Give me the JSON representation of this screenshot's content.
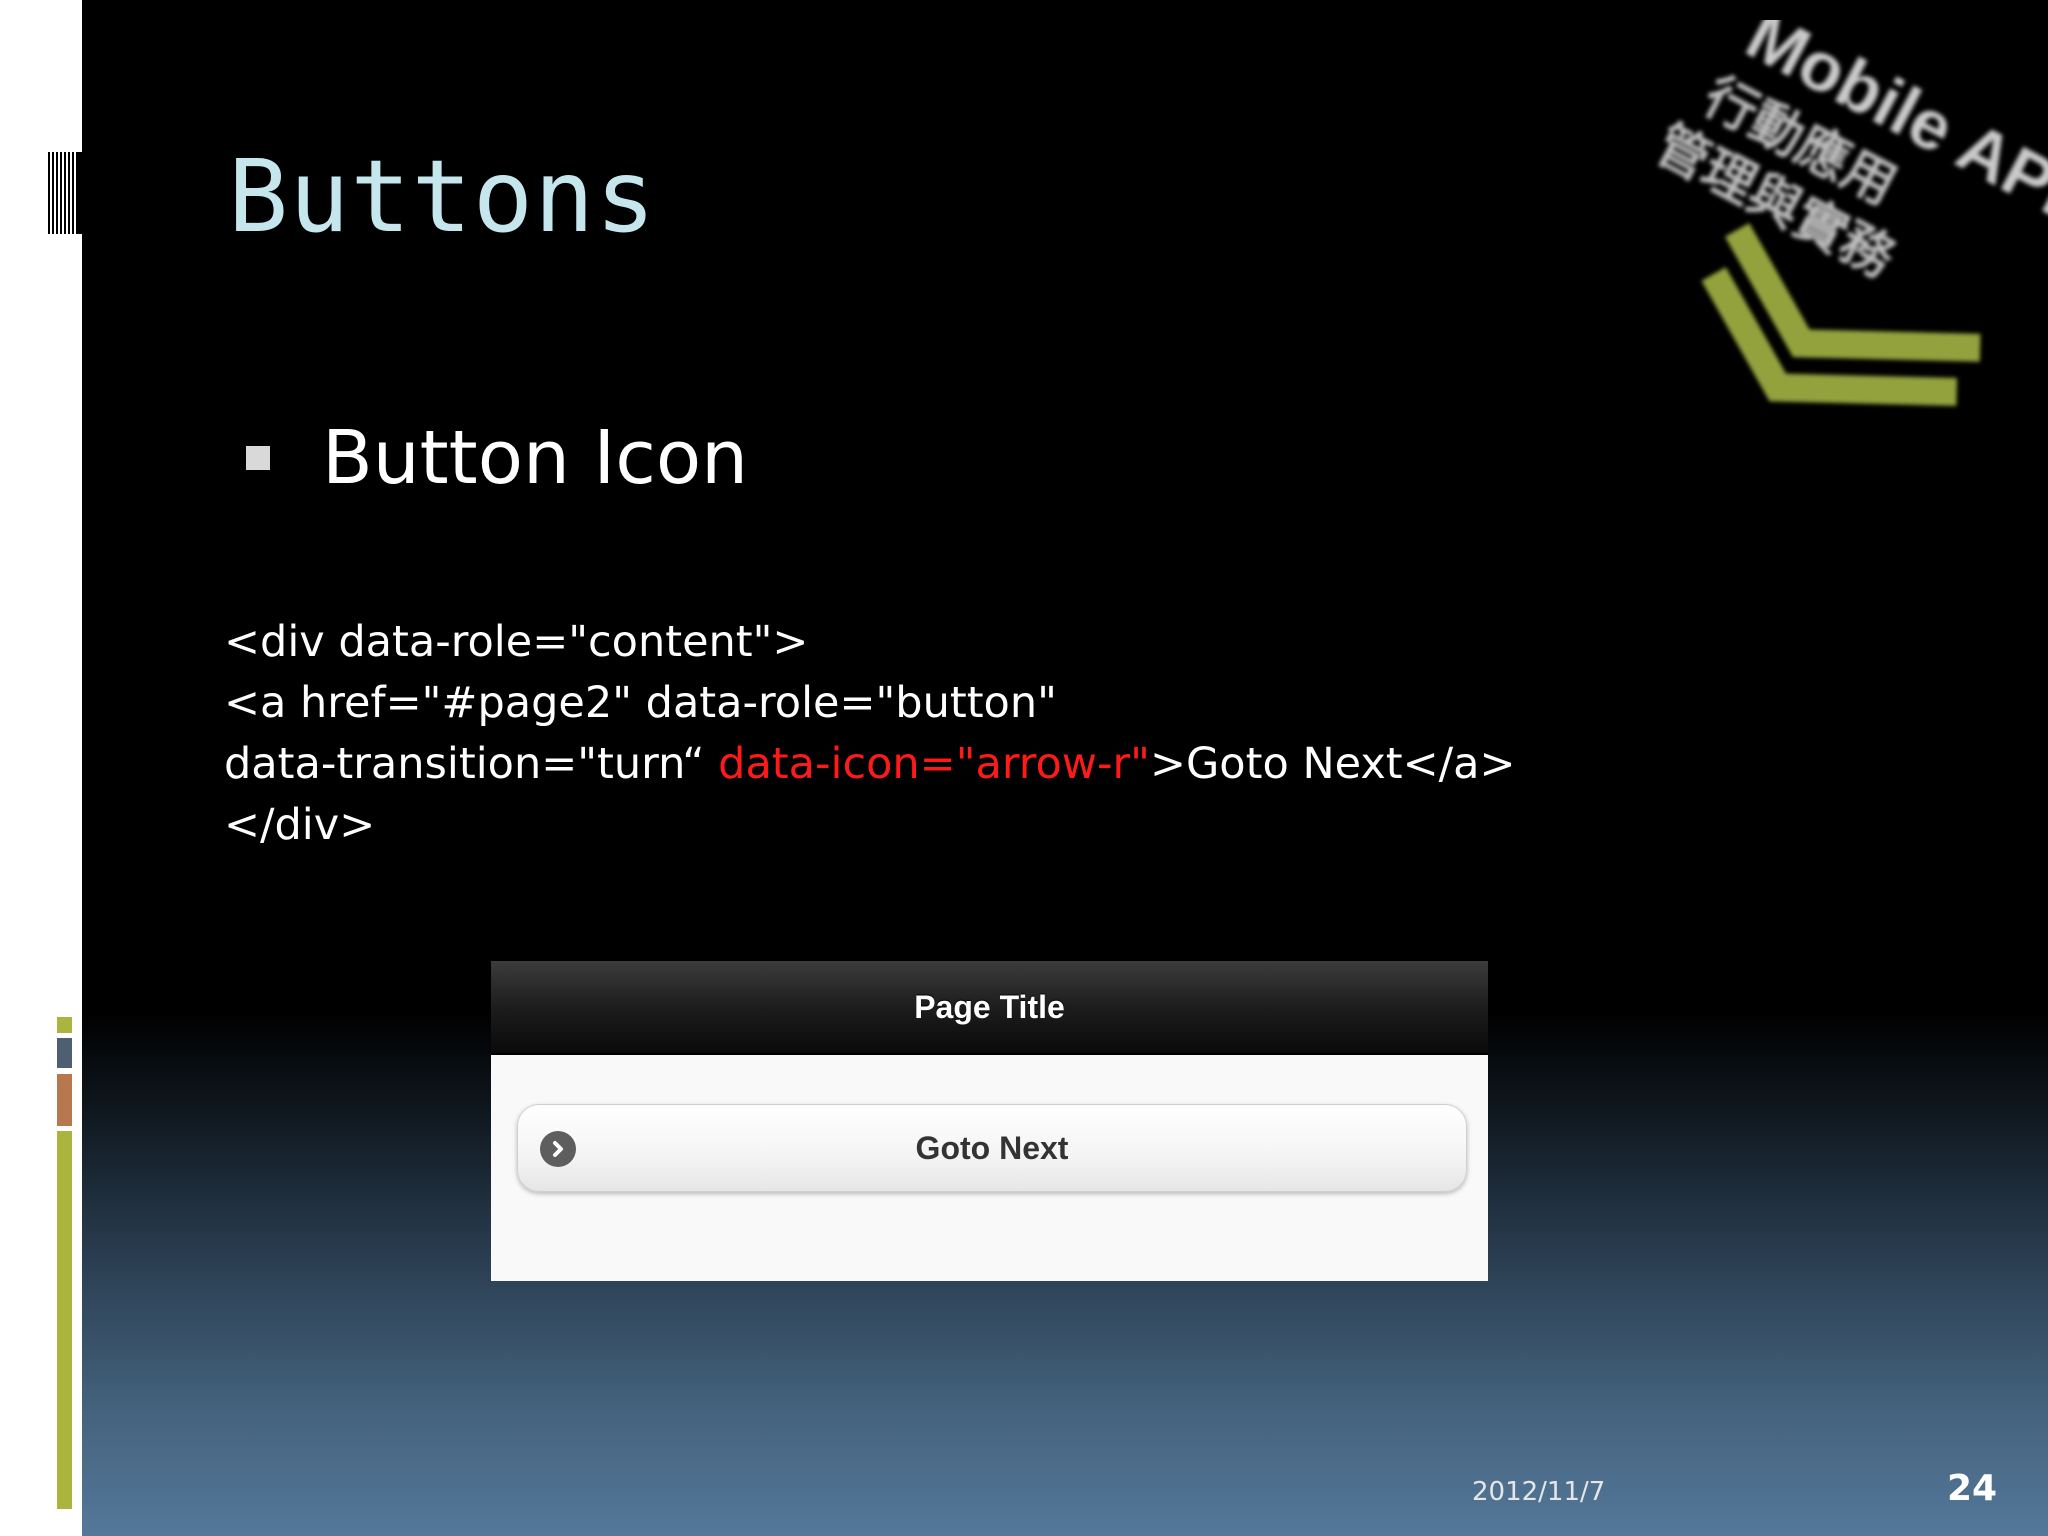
{
  "slide": {
    "title": "Buttons",
    "bullet": "Button Icon",
    "code": {
      "line1": "<div data-role=\"content\">",
      "line2": "<a href=\"#page2\" data-role=\"button\"",
      "line3_before": "data-transition=\"turn“ ",
      "line3_highlight": "data-icon=\"arrow-r\"",
      "line3_after": ">Goto Next</a>",
      "line4": "</div>"
    },
    "highlight_color": "#ff1a1a",
    "title_color": "#c5e6ec"
  },
  "logo": {
    "line1": "Mobile APP",
    "line2": "行動應用",
    "line3": "管理與實務",
    "accent_color": "#a4b445"
  },
  "demo": {
    "header_title": "Page Title",
    "button_label": "Goto Next",
    "button_icon": "arrow-right-icon"
  },
  "footer": {
    "date": "2012/11/7",
    "page_number": "24"
  },
  "sidebar_colors": [
    "#a9b53f",
    "#4d5f70",
    "#b8784f",
    "#a9b53f"
  ]
}
